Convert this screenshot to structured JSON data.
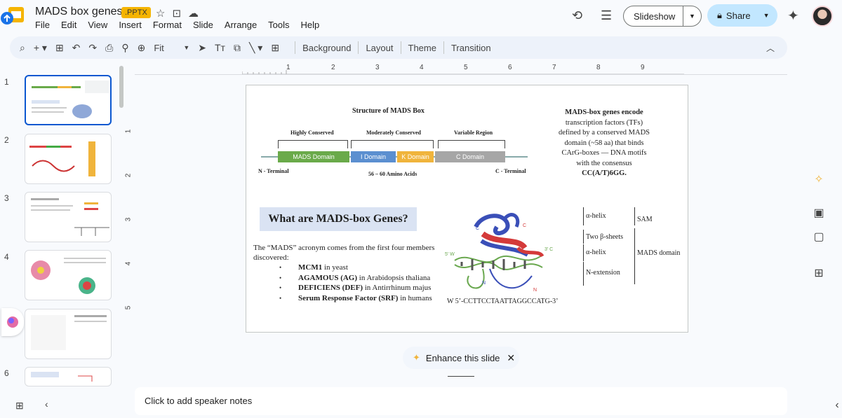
{
  "header": {
    "doc_title": "MADS box genes",
    "file_badge": ".PPTX",
    "menu": [
      "File",
      "Edit",
      "View",
      "Insert",
      "Format",
      "Slide",
      "Arrange",
      "Tools",
      "Help"
    ],
    "slideshow_label": "Slideshow",
    "share_label": "Share",
    "icons": [
      "star-icon",
      "move-folder-icon",
      "cloud-status-icon",
      "history-icon",
      "comments-icon",
      "gemini-icon"
    ]
  },
  "toolbar": {
    "zoom": "Fit",
    "background_label": "Background",
    "layout_label": "Layout",
    "theme_label": "Theme",
    "transition_label": "Transition"
  },
  "ruler": {
    "top_ticks": [
      "1",
      "2",
      "3",
      "4",
      "5",
      "6",
      "7",
      "8",
      "9"
    ],
    "left_ticks": [
      "1",
      "2",
      "3",
      "4",
      "5"
    ]
  },
  "filmstrip": {
    "slide_numbers": [
      "1",
      "2",
      "3",
      "4",
      "5",
      "6"
    ],
    "active_index": 1
  },
  "slide": {
    "structure_title": "Structure of MADS Box",
    "highly_conserved": "Highly Conserved",
    "moderately_conserved": "Moderately Conserved",
    "variable_region": "Variable Region",
    "domains": [
      "MADS Domain",
      "I Domain",
      "K Domain",
      "C Domain"
    ],
    "n_terminal": "N - Terminal",
    "c_terminal": "C - Terminal",
    "amino_acids": "56 – 60 Amino Acids",
    "description_lines": [
      "MADS-box genes encode",
      "transcription factors (TFs)",
      "defined by a conserved MADS",
      "domain (~58 aa) that binds",
      "CArG-boxes — DNA motifs",
      "with the consensus",
      "CC(A/T)6GG."
    ],
    "what_heading": "What are MADS-box Genes?",
    "acronym_line1": "The “MADS” acronym comes from the first four members",
    "acronym_line2": "discovered:",
    "members": [
      {
        "bold": "MCM1",
        "rest": " in yeast"
      },
      {
        "bold": "AGAMOUS (AG)",
        "rest": " in Arabidopsis thaliana"
      },
      {
        "bold": "DEFICIENS (DEF)",
        "rest": " in Antirrhinum majus"
      },
      {
        "bold": "Serum Response Factor (SRF)",
        "rest": " in humans"
      }
    ],
    "structure_labels": {
      "alpha_helix_1": "α-helix",
      "beta_sheets": "Two β-sheets",
      "alpha_helix_2": "α-helix",
      "n_extension": "N-extension",
      "sam": "SAM",
      "mads_domain": "MADS domain",
      "five_prime_w": "5′ W",
      "three_prime_c": "3′ C",
      "c_label": "C",
      "n_label": "N"
    },
    "dna_sequence": "W 5’-CCTTCCTAATTAGGCCATG-3’"
  },
  "enhance_label": "Enhance this slide",
  "notes_placeholder": "Click to add speaker notes",
  "colors": {
    "mads_domain": "#6aaa4a",
    "i_domain": "#5b8fd0",
    "k_domain": "#f0b43c",
    "c_domain": "#a6a6a6",
    "accent_blue": "#0b57d0",
    "share_bg": "#c2e7ff"
  }
}
